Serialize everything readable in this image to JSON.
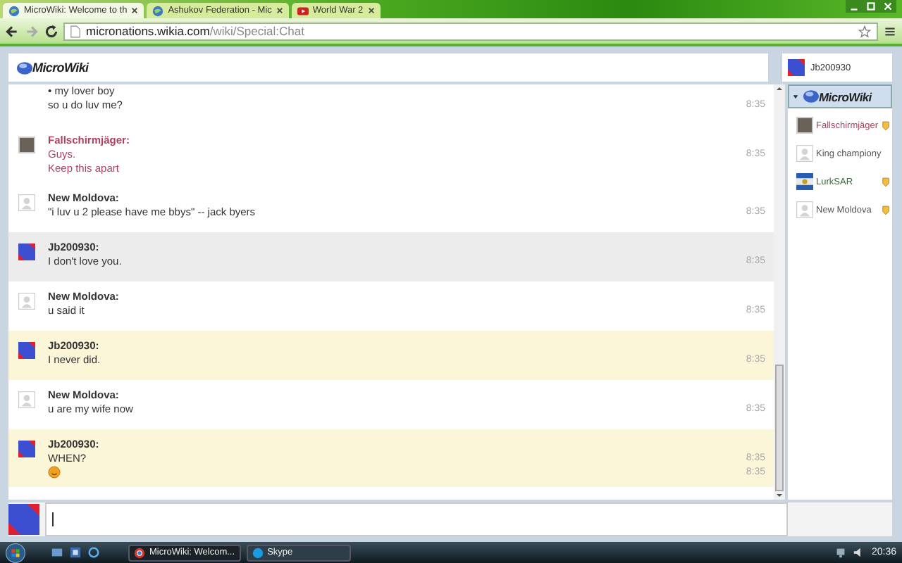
{
  "browser": {
    "tabs": [
      {
        "label": "MicroWiki: Welcome to th",
        "selected": true,
        "kind": "globe"
      },
      {
        "label": "Ashukov Federation - Mic",
        "selected": false,
        "kind": "globe"
      },
      {
        "label": "World War 2",
        "selected": false,
        "kind": "video"
      }
    ],
    "url_host": "micronations.wikia.com",
    "url_path": "/wiki/Special:Chat"
  },
  "chat": {
    "logo": "MicroWiki",
    "current_user": "Jb200930",
    "messages": [
      {
        "kind": "continued",
        "color": "#333333",
        "lines": [
          {
            "kind": "text",
            "text": "• my lover boy"
          },
          {
            "kind": "text",
            "text": "so u do luv me?",
            "time": "8:35"
          }
        ]
      },
      {
        "kind": "photo",
        "author": "Fallschirmjäger:",
        "color": "#b0405e",
        "lines": [
          {
            "kind": "text",
            "text": "Guys.",
            "time": "8:35"
          },
          {
            "kind": "text",
            "text": "Keep this apart"
          }
        ]
      },
      {
        "kind": "guest",
        "author": "New Moldova:",
        "color": "#333333",
        "lines": [
          {
            "kind": "text",
            "text": "\"i luv u 2 please have me bbys\" -- jack byers",
            "time": "8:35"
          }
        ]
      },
      {
        "kind": "own-hover",
        "author": "Jb200930:",
        "color": "#333333",
        "lines": [
          {
            "kind": "text",
            "text": "I don't love you.",
            "time": "8:35"
          }
        ]
      },
      {
        "kind": "guest",
        "author": "New Moldova:",
        "color": "#333333",
        "lines": [
          {
            "kind": "text",
            "text": "u said it",
            "time": "8:35"
          }
        ]
      },
      {
        "kind": "own",
        "author": "Jb200930:",
        "color": "#333333",
        "lines": [
          {
            "kind": "text",
            "text": "I never did.",
            "time": "8:35"
          }
        ]
      },
      {
        "kind": "guest",
        "author": "New Moldova:",
        "color": "#333333",
        "lines": [
          {
            "kind": "text",
            "text": "u are my wife now",
            "time": "8:35"
          }
        ]
      },
      {
        "kind": "own",
        "author": "Jb200930:",
        "color": "#333333",
        "lines": [
          {
            "kind": "text",
            "text": "WHEN?",
            "time": "8:35"
          },
          {
            "kind": "emoji",
            "time": "8:35"
          }
        ]
      }
    ],
    "room_logo": "MicroWiki",
    "users": [
      {
        "name": "Fallschirmjäger",
        "kind": "photo",
        "color": "#b0405e",
        "badge": true
      },
      {
        "name": "King championy",
        "kind": "guest",
        "color": "#555555",
        "badge": false
      },
      {
        "name": "LurkSAR",
        "kind": "flag",
        "color": "#3a6a3a",
        "badge": true
      },
      {
        "name": "New Moldova",
        "kind": "guest",
        "color": "#555555",
        "badge": true
      }
    ]
  },
  "taskbar": {
    "windows": [
      {
        "label": "MicroWiki: Welcom...",
        "kind": "browser",
        "selected": true
      },
      {
        "label": "Skype",
        "kind": "chat",
        "selected": false
      }
    ],
    "clock": "20:36"
  }
}
